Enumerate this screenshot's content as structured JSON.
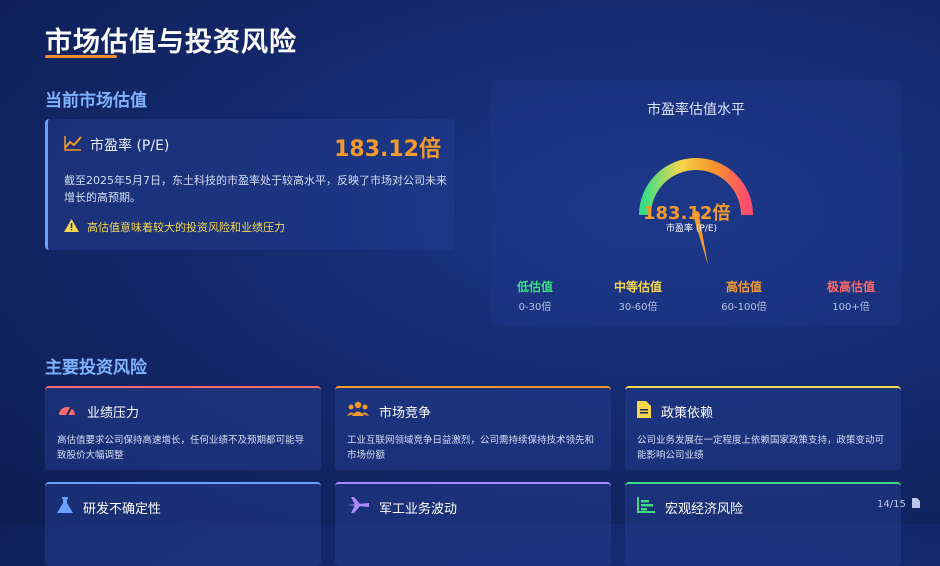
{
  "page": {
    "title": "市场估值与投资风险"
  },
  "valuation": {
    "section_title": "当前市场估值",
    "pe_label": "市盈率 (P/E)",
    "pe_value": "183.12倍",
    "description": "截至2025年5月7日，东土科技的市盈率处于较高水平，反映了市场对公司未来增长的高预期。",
    "warning": "高估值意味着较大的投资风险和业绩压力"
  },
  "gauge": {
    "title": "市盈率估值水平",
    "value_text": "183.12倍",
    "sub_label": "市盈率 (P/E)",
    "needle_fraction": 0.88,
    "legend": [
      {
        "name": "低估值",
        "range": "0-30倍",
        "color": "#3ddc84"
      },
      {
        "name": "中等估值",
        "range": "30-60倍",
        "color": "#f5d64c"
      },
      {
        "name": "高估值",
        "range": "60-100倍",
        "color": "#f39a2a"
      },
      {
        "name": "极高估值",
        "range": "100+倍",
        "color": "#ff6b6b"
      }
    ]
  },
  "risks": {
    "section_title": "主要投资风险",
    "items": [
      {
        "title": "业绩压力",
        "desc": "高估值要求公司保持高速增长，任何业绩不及预期都可能导致股价大幅调整",
        "icon": "speedometer-icon",
        "color": "#ff6b6b"
      },
      {
        "title": "市场竞争",
        "desc": "工业互联网领域竞争日益激烈，公司需持续保持技术领先和市场份额",
        "icon": "users-icon",
        "color": "#f39a2a"
      },
      {
        "title": "政策依赖",
        "desc": "公司业务发展在一定程度上依赖国家政策支持，政策变动可能影响公司业绩",
        "icon": "document-icon",
        "color": "#f5d64c"
      },
      {
        "title": "研发不确定性",
        "desc": "",
        "icon": "flask-icon",
        "color": "#6aa0ff"
      },
      {
        "title": "军工业务波动",
        "desc": "",
        "icon": "plane-icon",
        "color": "#a98bff"
      },
      {
        "title": "宏观经济风险",
        "desc": "",
        "icon": "bar-chart-icon",
        "color": "#3ddc84"
      }
    ]
  },
  "footer": {
    "page_indicator": "14/15"
  }
}
